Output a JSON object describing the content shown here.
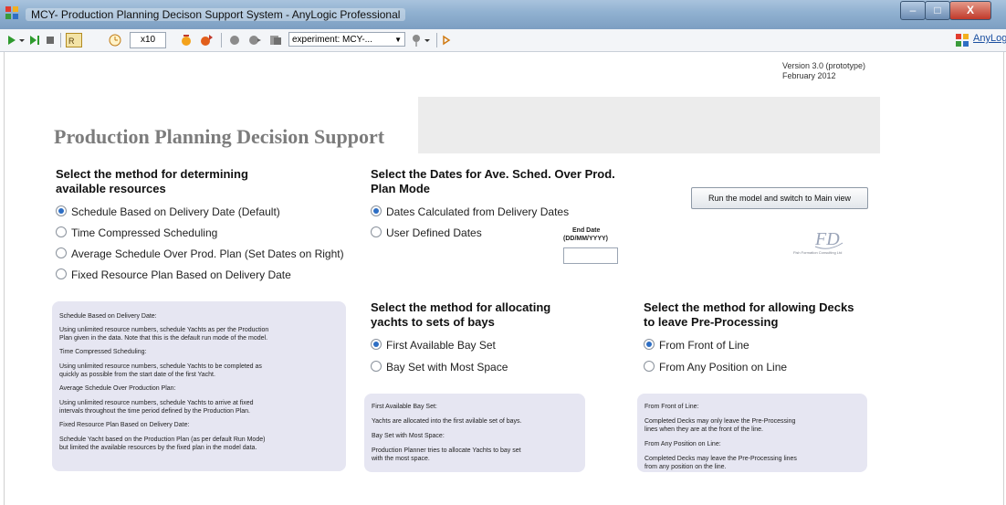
{
  "window": {
    "title": "MCY- Production Planning Decison Support System - AnyLogic Professional",
    "min_symbol": "–",
    "max_symbol": "□",
    "close_symbol": "X"
  },
  "toolbar": {
    "speed": "x10",
    "experiment": "experiment: MCY-...",
    "brand_link": "AnyLogic"
  },
  "version": {
    "line1": "Version 3.0 (prototype)",
    "line2": "February 2012"
  },
  "page_title": "Production Planning Decision Support",
  "resources": {
    "heading_line1": "Select the method for determining",
    "heading_line2": "available resources",
    "options": [
      {
        "label": "Schedule Based on Delivery Date (Default)",
        "selected": true
      },
      {
        "label": "Time Compressed Scheduling",
        "selected": false
      },
      {
        "label": "Average Schedule Over Prod. Plan (Set Dates on Right)",
        "selected": false
      },
      {
        "label": "Fixed Resource Plan Based on Delivery Date",
        "selected": false
      }
    ]
  },
  "dates": {
    "heading_line1": "Select the Dates for Ave. Sched. Over Prod.",
    "heading_line2": "Plan Mode",
    "options": [
      {
        "label": "Dates Calculated from Delivery Dates",
        "selected": true
      },
      {
        "label": "User Defined Dates",
        "selected": false
      }
    ],
    "end_date_label_line1": "End Date",
    "end_date_label_line2": "(DD/MM/YYYY)",
    "end_date_value": ""
  },
  "run_button": "Run the model and switch to Main view",
  "logo": {
    "mark": "FD",
    "caption": "Fish Formation Consulting Ltd"
  },
  "bays": {
    "heading_line1": "Select the method for allocating",
    "heading_line2": "yachts to sets of bays",
    "options": [
      {
        "label": "First Available Bay Set",
        "selected": true
      },
      {
        "label": "Bay Set with Most Space",
        "selected": false
      }
    ]
  },
  "decks": {
    "heading_line1": "Select the method for allowing Decks",
    "heading_line2": "to leave Pre-Processing",
    "options": [
      {
        "label": "From Front of Line",
        "selected": true
      },
      {
        "label": "From Any Position on Line",
        "selected": false
      }
    ]
  },
  "resources_help": [
    "Schedule Based on Delivery Date:",
    "Using unlimited resource numbers, schedule Yachts as per the Production",
    "Plan given in the data. Note that this is the default run mode of the model.",
    "Time Compressed Scheduling:",
    "Using unlimited resource numbers, schedule Yachts to be completed as",
    "quickly as possible from the start date of the first Yacht.",
    "Average Schedule Over Production Plan:",
    "Using unlimited resource numbers, schedule Yachts to arrive at fixed",
    "intervals throughout the time period defined by the Production Plan.",
    "Fixed Resource Plan Based on Delivery Date:",
    "Schedule Yacht based on the Production Plan (as per default Run Mode)",
    "but limited the available resources by the fixed plan in the model data."
  ],
  "bays_help": [
    "First Available Bay Set:",
    "Yachts are allocated into the first avilable set of bays.",
    "Bay Set with Most Space:",
    "Production Planner tries to allocate Yachts to bay set",
    "with the most space."
  ],
  "decks_help": [
    "From Front of Line:",
    "Completed Decks may only leave the Pre-Processing",
    "lines when they are at the front of the line.",
    "From Any Position on Line:",
    "Completed Decks may leave the Pre-Processing lines",
    "from any position on the line."
  ]
}
